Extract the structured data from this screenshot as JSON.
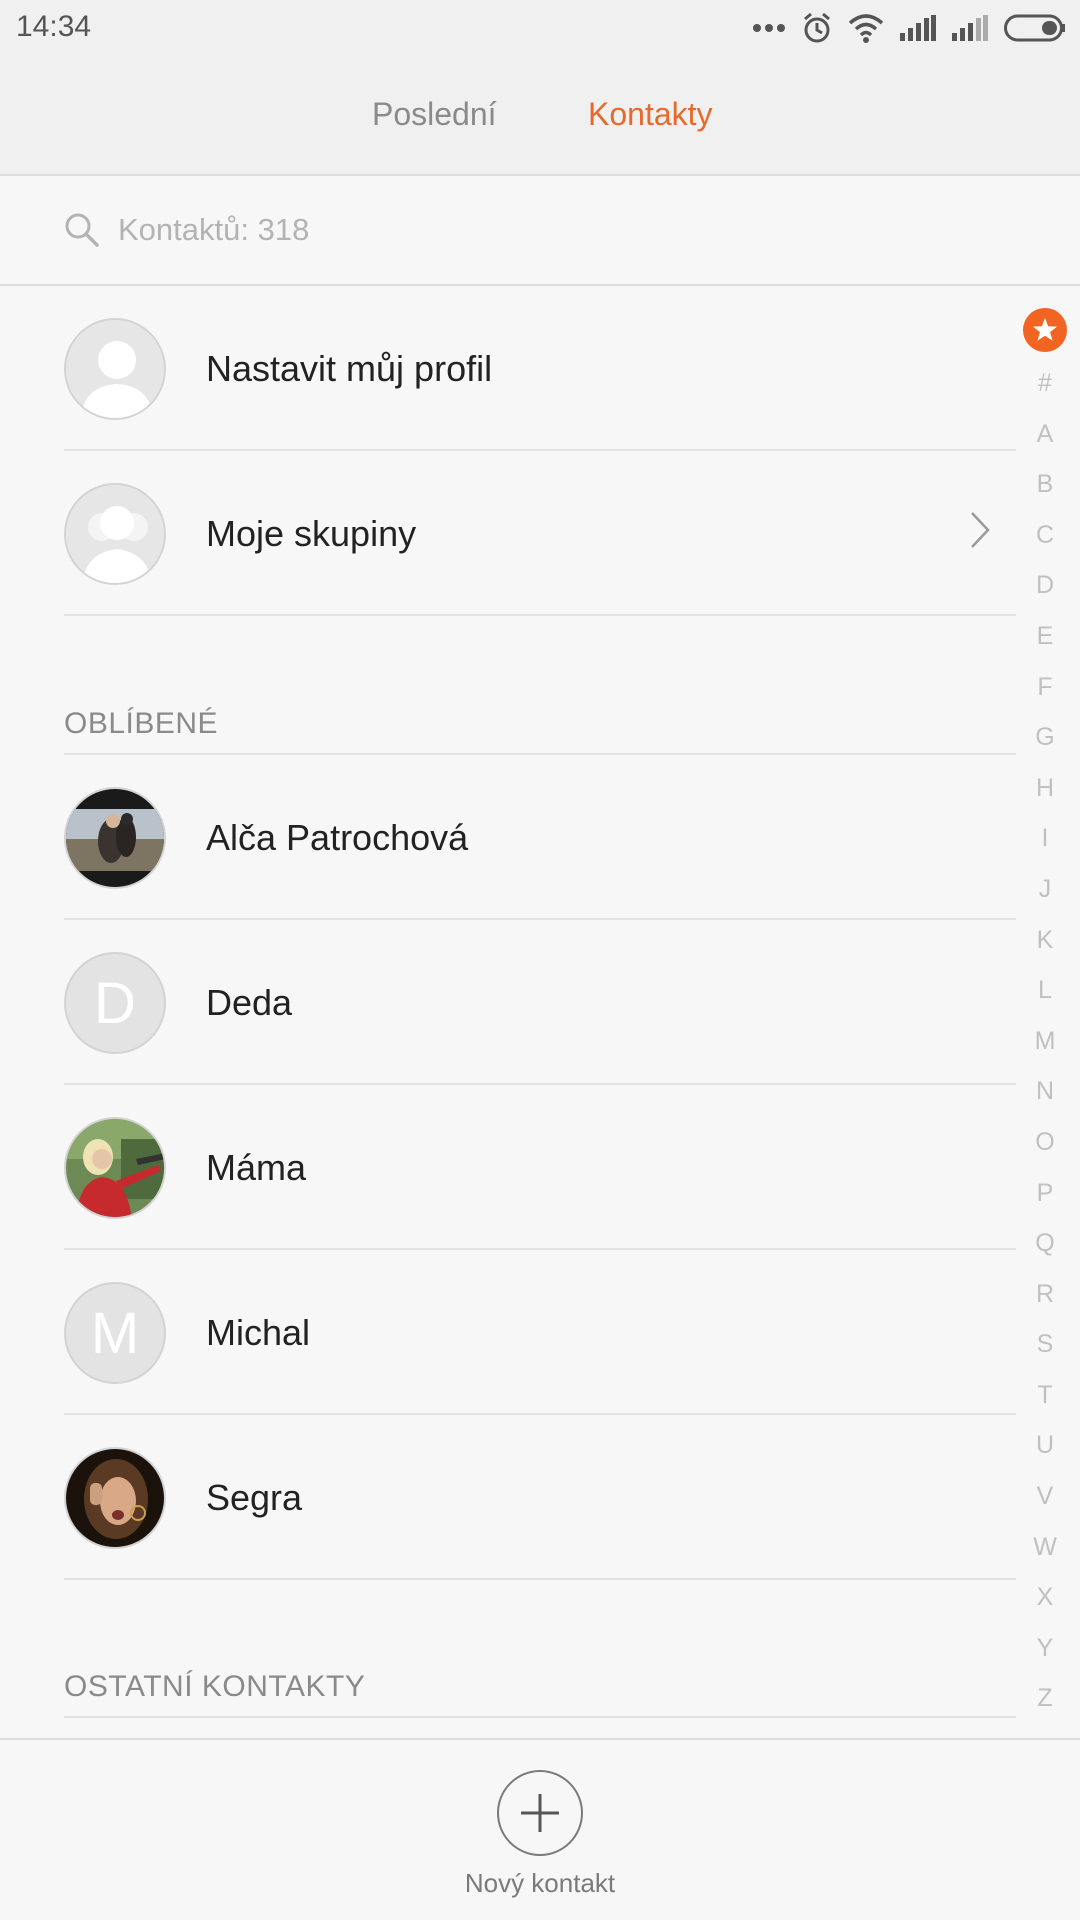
{
  "status_bar": {
    "time": "14:34",
    "icons": [
      "more-dots-icon",
      "alarm-icon",
      "wifi-icon",
      "signal-icon",
      "signal-weak-icon",
      "battery-icon"
    ]
  },
  "tabs": [
    {
      "label": "Poslední",
      "active": false
    },
    {
      "label": "Kontakty",
      "active": true
    }
  ],
  "search": {
    "placeholder": "Kontaktů: 318"
  },
  "top_items": [
    {
      "name": "Nastavit můj profil",
      "icon": "profile-placeholder-icon"
    },
    {
      "name": "Moje skupiny",
      "icon": "group-placeholder-icon",
      "chevron": "chevron-right-icon"
    }
  ],
  "favorites": {
    "header": "OBLÍBENÉ",
    "contacts": [
      {
        "name": "Alča Patrochová",
        "avatar": "photo"
      },
      {
        "name": "Deda",
        "avatar_letter": "D"
      },
      {
        "name": "Máma",
        "avatar": "photo"
      },
      {
        "name": "Michal",
        "avatar_letter": "M"
      },
      {
        "name": "Segra",
        "avatar": "photo"
      }
    ]
  },
  "other_contacts": {
    "header": "OSTATNÍ KONTAKTY"
  },
  "alphabet_index": {
    "favorites_icon": "star-icon",
    "letters": [
      "#",
      "A",
      "B",
      "C",
      "D",
      "E",
      "F",
      "G",
      "H",
      "I",
      "J",
      "K",
      "L",
      "M",
      "N",
      "O",
      "P",
      "Q",
      "R",
      "S",
      "T",
      "U",
      "V",
      "W",
      "X",
      "Y",
      "Z"
    ]
  },
  "bottom": {
    "add_label": "Nový kontakt"
  },
  "colors": {
    "accent": "#e8692a",
    "background": "#f7f7f7",
    "bar_background": "#f0f0f0",
    "divider": "#e2e2e2",
    "muted_text": "#8a8a8a"
  }
}
